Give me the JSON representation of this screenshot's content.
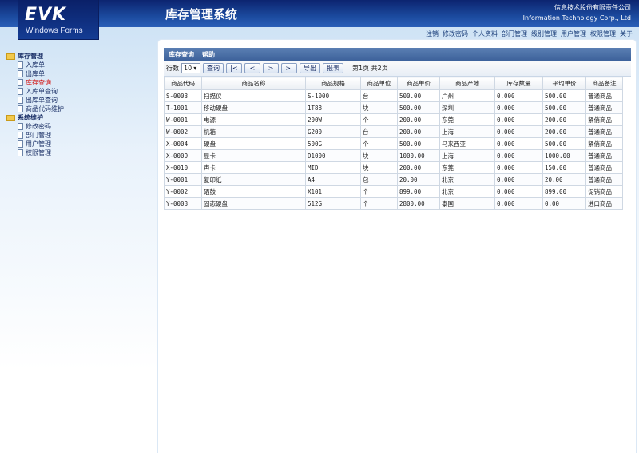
{
  "header": {
    "logo_text": "EVK",
    "logo_sub": "Windows Forms",
    "title": "库存管理系统",
    "company_cn": "信息技术股份有限责任公司",
    "company_en": "Information Technology Corp., Ltd"
  },
  "topnav": [
    "注销",
    "修改密码",
    "个人资料",
    "部门管理",
    "级别管理",
    "用户管理",
    "权限管理",
    "关于"
  ],
  "sidebar": {
    "groups": [
      {
        "label": "库存管理",
        "items": [
          {
            "label": "入库单",
            "active": false
          },
          {
            "label": "出库单",
            "active": false
          },
          {
            "label": "库存查询",
            "active": true
          },
          {
            "label": "入库单查询",
            "active": false
          },
          {
            "label": "出库单查询",
            "active": false
          },
          {
            "label": "商品代码维护",
            "active": false
          }
        ]
      },
      {
        "label": "系统维护",
        "items": [
          {
            "label": "修改密码",
            "active": false
          },
          {
            "label": "部门管理",
            "active": false
          },
          {
            "label": "用户管理",
            "active": false
          },
          {
            "label": "权限管理",
            "active": false
          }
        ]
      }
    ]
  },
  "panel": {
    "tab_query": "库存查询",
    "tab_help": "帮助"
  },
  "toolbar": {
    "rows_label": "行数",
    "rows_value": "10",
    "query": "查询",
    "first": "|<",
    "prev": "<",
    "next": ">",
    "last": ">|",
    "export": "导出",
    "report": "报表",
    "page_info": "第1页 共2页"
  },
  "table": {
    "headers": [
      "商品代码",
      "商品名称",
      "商品规格",
      "商品单位",
      "商品单价",
      "商品产地",
      "库存数量",
      "平均单价",
      "商品备注"
    ],
    "rows": [
      [
        "S-0003",
        "扫描仪",
        "S-1000",
        "台",
        "500.00",
        "广州",
        "0.000",
        "500.00",
        "普通商品"
      ],
      [
        "T-1001",
        "移动硬盘",
        "1T88",
        "块",
        "500.00",
        "深圳",
        "0.000",
        "500.00",
        "普通商品"
      ],
      [
        "W-0001",
        "电源",
        "200W",
        "个",
        "200.00",
        "东莞",
        "0.000",
        "200.00",
        "紧俏商品"
      ],
      [
        "W-0002",
        "机箱",
        "G200",
        "台",
        "200.00",
        "上海",
        "0.000",
        "200.00",
        "普通商品"
      ],
      [
        "X-0004",
        "硬盘",
        "500G",
        "个",
        "500.00",
        "马来西亚",
        "0.000",
        "500.00",
        "紧俏商品"
      ],
      [
        "X-0009",
        "显卡",
        "D1000",
        "块",
        "1000.00",
        "上海",
        "0.000",
        "1000.00",
        "普通商品"
      ],
      [
        "X-0010",
        "声卡",
        "MID",
        "块",
        "200.00",
        "东莞",
        "0.000",
        "150.00",
        "普通商品"
      ],
      [
        "Y-0001",
        "复印纸",
        "A4",
        "包",
        "20.00",
        "北京",
        "0.000",
        "20.00",
        "普通商品"
      ],
      [
        "Y-0002",
        "硒鼓",
        "X101",
        "个",
        "899.00",
        "北京",
        "0.000",
        "899.00",
        "促销商品"
      ],
      [
        "Y-0003",
        "固态硬盘",
        "512G",
        "个",
        "2800.00",
        "泰国",
        "0.000",
        "0.00",
        "进口商品"
      ]
    ]
  }
}
